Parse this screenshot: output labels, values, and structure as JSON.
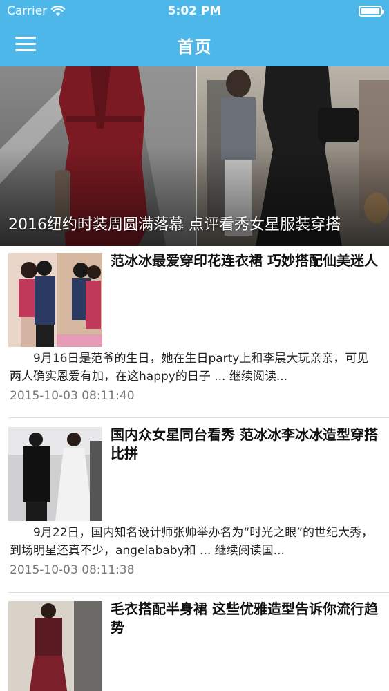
{
  "status_bar": {
    "carrier": "Carrier",
    "time": "5:02 PM",
    "battery_level": 1.0
  },
  "nav": {
    "title": "首页",
    "menu_icon": "hamburger-icon"
  },
  "hero": {
    "caption": "2016纽约时装周圆满落幕 点评看秀女星服装穿搭"
  },
  "articles": [
    {
      "title": "范冰冰最爱穿印花连衣裙 巧妙搭配仙美迷人",
      "summary": "9月16日是范爷的生日，她在生日party上和李晨大玩亲亲，可见两人确实恩爱有加，在这happy的日子 ... 继续阅读...",
      "date": "2015-10-03 08:11:40"
    },
    {
      "title": "国内众女星同台看秀 范冰冰李冰冰造型穿搭比拼",
      "summary": "9月22日，国内知名设计师张帅举办名为“时光之眼”的世纪大秀，到场明星还真不少，angelababy和 ... 继续阅读国...",
      "date": "2015-10-03 08:11:38"
    },
    {
      "title": "毛衣搭配半身裙 这些优雅造型告诉你流行趋势",
      "summary": "",
      "date": ""
    }
  ],
  "colors": {
    "accent": "#4eb7ea",
    "date_text": "#777777",
    "divider": "#dddddd"
  }
}
